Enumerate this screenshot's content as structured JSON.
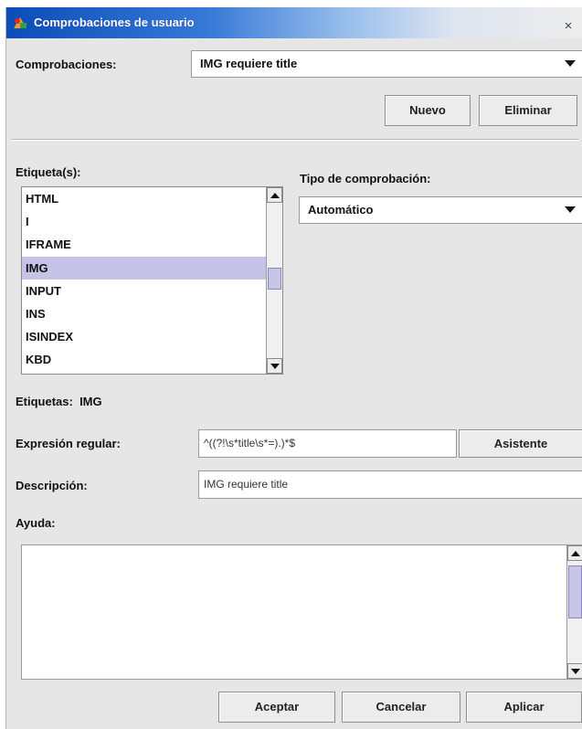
{
  "window": {
    "title": "Comprobaciones de usuario",
    "close_glyph": "×"
  },
  "checks": {
    "label": "Comprobaciones:",
    "selected": "IMG requiere title",
    "new_label": "Nuevo",
    "delete_label": "Eliminar"
  },
  "tags": {
    "label": "Etiqueta(s):",
    "items": [
      "HTML",
      "I",
      "IFRAME",
      "IMG",
      "INPUT",
      "INS",
      "ISINDEX",
      "KBD"
    ],
    "selected_index": 3,
    "summary": "Etiquetas:  IMG"
  },
  "check_type": {
    "label": "Tipo de comprobación:",
    "selected": "Automático"
  },
  "regex": {
    "label": "Expresión regular:",
    "value": "^((?!\\s*title\\s*=).)*$",
    "assistant_label": "Asistente"
  },
  "description": {
    "label": "Descripción:",
    "value": "IMG requiere title"
  },
  "help": {
    "label": "Ayuda:",
    "value": ""
  },
  "footer": {
    "accept_label": "Aceptar",
    "cancel_label": "Cancelar",
    "apply_label": "Aplicar"
  },
  "colors": {
    "titlebar": "#0b4db8",
    "selection": "#c6c3e8",
    "window_bg": "#e6e6e6"
  },
  "icons": {
    "title_icon": "app-icon",
    "dropdown": "triangle-down-icon",
    "scroll_up": "triangle-up-icon",
    "scroll_down": "triangle-down-icon"
  }
}
